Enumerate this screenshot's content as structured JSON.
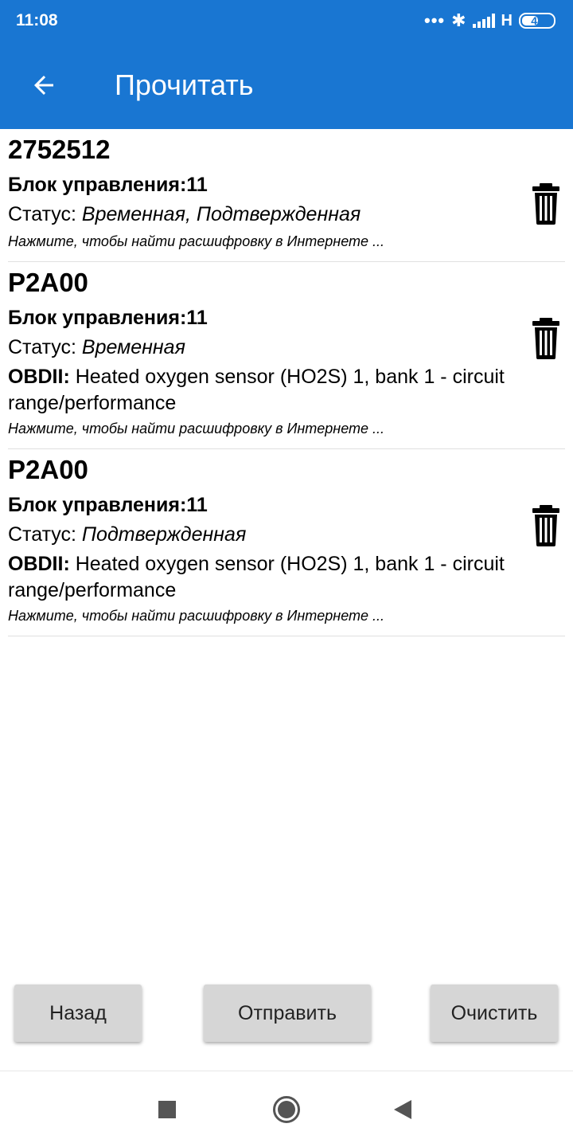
{
  "statusbar": {
    "time": "11:08",
    "dots": "•••",
    "bluetooth": "✱",
    "network": "H",
    "battery": "48"
  },
  "appbar": {
    "title": "Прочитать",
    "back_icon": "arrow-left-icon"
  },
  "items": [
    {
      "code": "2752512",
      "block_label": "Блок управления:11",
      "status_prefix": "Статус: ",
      "status_value": "Временная, Подтвержденная",
      "obd_prefix": "",
      "obd_text": "",
      "hint": "Нажмите, чтобы найти расшифровку в Интернете ..."
    },
    {
      "code": "P2A00",
      "block_label": "Блок управления:11",
      "status_prefix": "Статус: ",
      "status_value": "Временная",
      "obd_prefix": "OBDII:",
      "obd_text": " Heated oxygen sensor (HO2S) 1, bank 1 - circuit range/performance",
      "hint": "Нажмите, чтобы найти расшифровку в Интернете ..."
    },
    {
      "code": "P2A00",
      "block_label": "Блок управления:11",
      "status_prefix": "Статус: ",
      "status_value": "Подтвержденная",
      "obd_prefix": "OBDII:",
      "obd_text": " Heated oxygen sensor (HO2S) 1, bank 1 - circuit range/performance",
      "hint": "Нажмите, чтобы найти расшифровку в Интернете ..."
    }
  ],
  "buttons": {
    "back": "Назад",
    "send": "Отправить",
    "clear": "Очистить"
  },
  "colors": {
    "accent": "#1976d2",
    "button_bg": "#d6d6d6"
  }
}
